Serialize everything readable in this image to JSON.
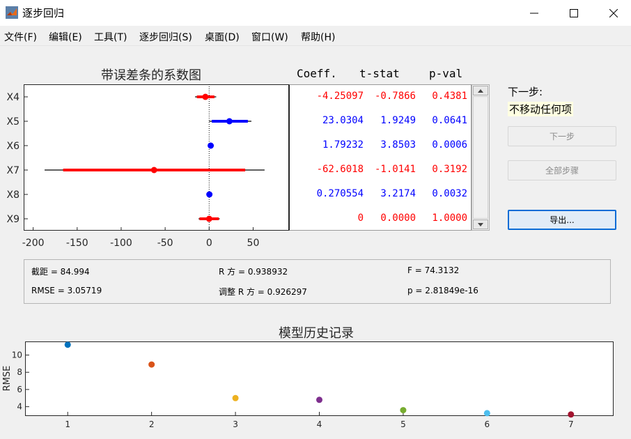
{
  "window": {
    "title": "逐步回归"
  },
  "menu": [
    "文件(F)",
    "编辑(E)",
    "工具(T)",
    "逐步回归(S)",
    "桌面(D)",
    "窗口(W)",
    "帮助(H)"
  ],
  "coef_plot": {
    "title": "带误差条的系数图"
  },
  "table": {
    "headers": [
      "Coeff.",
      "t-stat",
      "p-val"
    ],
    "rows": [
      {
        "coeff": "-4.25097",
        "tstat": "-0.7866",
        "pval": "0.4381",
        "color": "#ff0000"
      },
      {
        "coeff": "23.0304",
        "tstat": "1.9249",
        "pval": "0.0641",
        "color": "#0000ff"
      },
      {
        "coeff": "1.79232",
        "tstat": "3.8503",
        "pval": "0.0006",
        "color": "#0000ff"
      },
      {
        "coeff": "-62.6018",
        "tstat": "-1.0141",
        "pval": "0.3192",
        "color": "#ff0000"
      },
      {
        "coeff": "0.270554",
        "tstat": "3.2174",
        "pval": "0.0032",
        "color": "#0000ff"
      },
      {
        "coeff": "0",
        "tstat": "0.0000",
        "pval": "1.0000",
        "color": "#ff0000"
      }
    ]
  },
  "side": {
    "next_label": "下一步:",
    "next_desc": "不移动任何项",
    "next_button": "下一步",
    "all_steps_button": "全部步骤",
    "export_button": "导出..."
  },
  "stats": {
    "intercept": "截距 = 84.994",
    "r2": "R 方 = 0.938932",
    "f": "F = 74.3132",
    "rmse": "RMSE = 3.05719",
    "adj_r2": "调整 R 方 = 0.926297",
    "p": "p = 2.81849e-16"
  },
  "history_plot": {
    "title": "模型历史记录"
  },
  "chart_data": [
    {
      "type": "scatter",
      "title": "带误差条的系数图",
      "categories": [
        "X4",
        "X5",
        "X6",
        "X7",
        "X8",
        "X9"
      ],
      "estimates": [
        -4.25,
        23.03,
        1.79,
        -62.6,
        0.27,
        0
      ],
      "ci_inner": [
        [
          -14,
          6
        ],
        [
          3,
          44
        ],
        [
          0.5,
          3.2
        ],
        [
          -166,
          41
        ],
        [
          0.1,
          0.45
        ],
        [
          -11,
          11
        ]
      ],
      "ci_outer": [
        [
          -16,
          8
        ],
        [
          0,
          48
        ],
        [
          0.2,
          3.5
        ],
        [
          -187,
          63
        ],
        [
          0.05,
          0.5
        ],
        [
          -12,
          12
        ]
      ],
      "colors": [
        "#ff0000",
        "#0000ff",
        "#0000ff",
        "#ff0000",
        "#0000ff",
        "#ff0000"
      ],
      "xlim": [
        -210,
        90
      ],
      "xticks": [
        -200,
        -150,
        -100,
        -50,
        0,
        50
      ],
      "zero_line": "dotted"
    },
    {
      "type": "scatter",
      "title": "模型历史记录",
      "x": [
        1,
        2,
        3,
        4,
        5,
        6,
        7
      ],
      "y": [
        11.2,
        8.9,
        5.0,
        4.8,
        3.6,
        3.25,
        3.1
      ],
      "colors": [
        "#0072bd",
        "#d95319",
        "#edb120",
        "#7e2f8e",
        "#77ac30",
        "#4dbeee",
        "#a2142f"
      ],
      "ylabel": "RMSE",
      "xlim": [
        0.5,
        7.5
      ],
      "ylim": [
        3,
        11.5
      ],
      "xticks": [
        1,
        2,
        3,
        4,
        5,
        6,
        7
      ],
      "yticks": [
        4,
        6,
        8,
        10
      ]
    }
  ]
}
